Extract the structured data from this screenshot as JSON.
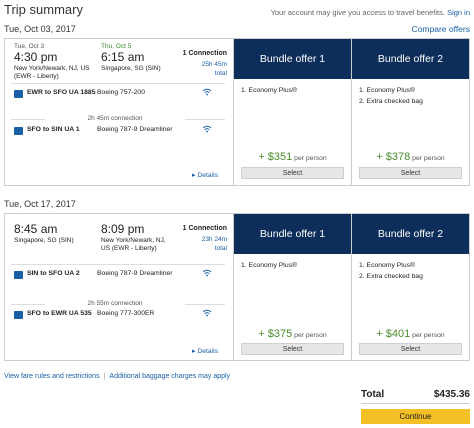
{
  "header": {
    "title": "Trip summary",
    "account_note": "Your account may give you access to travel benefits.",
    "sign_in": "Sign in",
    "compare_offers": "Compare offers"
  },
  "trips": [
    {
      "date": "Tue, Oct 03, 2017",
      "depart_day": "Tue, Oct 3",
      "depart_time": "4:30 pm",
      "depart_place": "New York/Newark, NJ, US (EWR - Liberty)",
      "arrive_day": "Thu, Oct 5",
      "arrive_time": "6:15 am",
      "arrive_place": "Singapore, SG (SIN)",
      "connections": "1 Connection",
      "duration": "25h 45m",
      "duration_note": "total",
      "segments": [
        {
          "route": "EWR to SFO",
          "flight": "UA 1885",
          "aircraft": "Boeing 757-200"
        },
        {
          "route": "SFO to SIN",
          "flight": "UA 1",
          "aircraft": "Boeing 787-9 Dreamliner"
        }
      ],
      "layover": "2h 45m connection",
      "details": "Details",
      "offers": [
        {
          "name": "Bundle offer 1",
          "benefits": [
            "1. Economy Plus®"
          ],
          "price": "+ $351",
          "per": "per person",
          "select": "Select"
        },
        {
          "name": "Bundle offer 2",
          "benefits": [
            "1. Economy Plus®",
            "2. Extra checked bag"
          ],
          "price": "+ $378",
          "per": "per person",
          "select": "Select"
        }
      ]
    },
    {
      "date": "Tue, Oct 17, 2017",
      "depart_time": "8:45 am",
      "depart_place": "Singapore, SG (SIN)",
      "arrive_time": "8:09 pm",
      "arrive_place": "New York/Newark, NJ, US (EWR - Liberty)",
      "connections": "1 Connection",
      "duration": "23h 24m",
      "duration_note": "total",
      "segments": [
        {
          "route": "SIN to SFO",
          "flight": "UA 2",
          "aircraft": "Boeing 787-9 Dreamliner"
        },
        {
          "route": "SFO to EWR",
          "flight": "UA 535",
          "aircraft": "Boeing 777-300ER"
        }
      ],
      "layover": "2h 55m connection",
      "details": "Details",
      "offers": [
        {
          "name": "Bundle offer 1",
          "benefits": [
            "1. Economy Plus®"
          ],
          "price": "+ $375",
          "per": "per person",
          "select": "Select"
        },
        {
          "name": "Bundle offer 2",
          "benefits": [
            "1. Economy Plus®",
            "2. Extra checked bag"
          ],
          "price": "+ $401",
          "per": "per person",
          "select": "Select"
        }
      ]
    }
  ],
  "footer": {
    "fare_rules": "View fare rules and restrictions",
    "baggage": "Additional baggage charges may apply",
    "total_label": "Total",
    "total_value": "$435.36",
    "continue": "Continue"
  },
  "colors": {
    "offer_header": "#0d2d5a",
    "price_green": "#4a8c2a",
    "link_blue": "#1a5fa6",
    "continue_yellow": "#f4c025"
  }
}
